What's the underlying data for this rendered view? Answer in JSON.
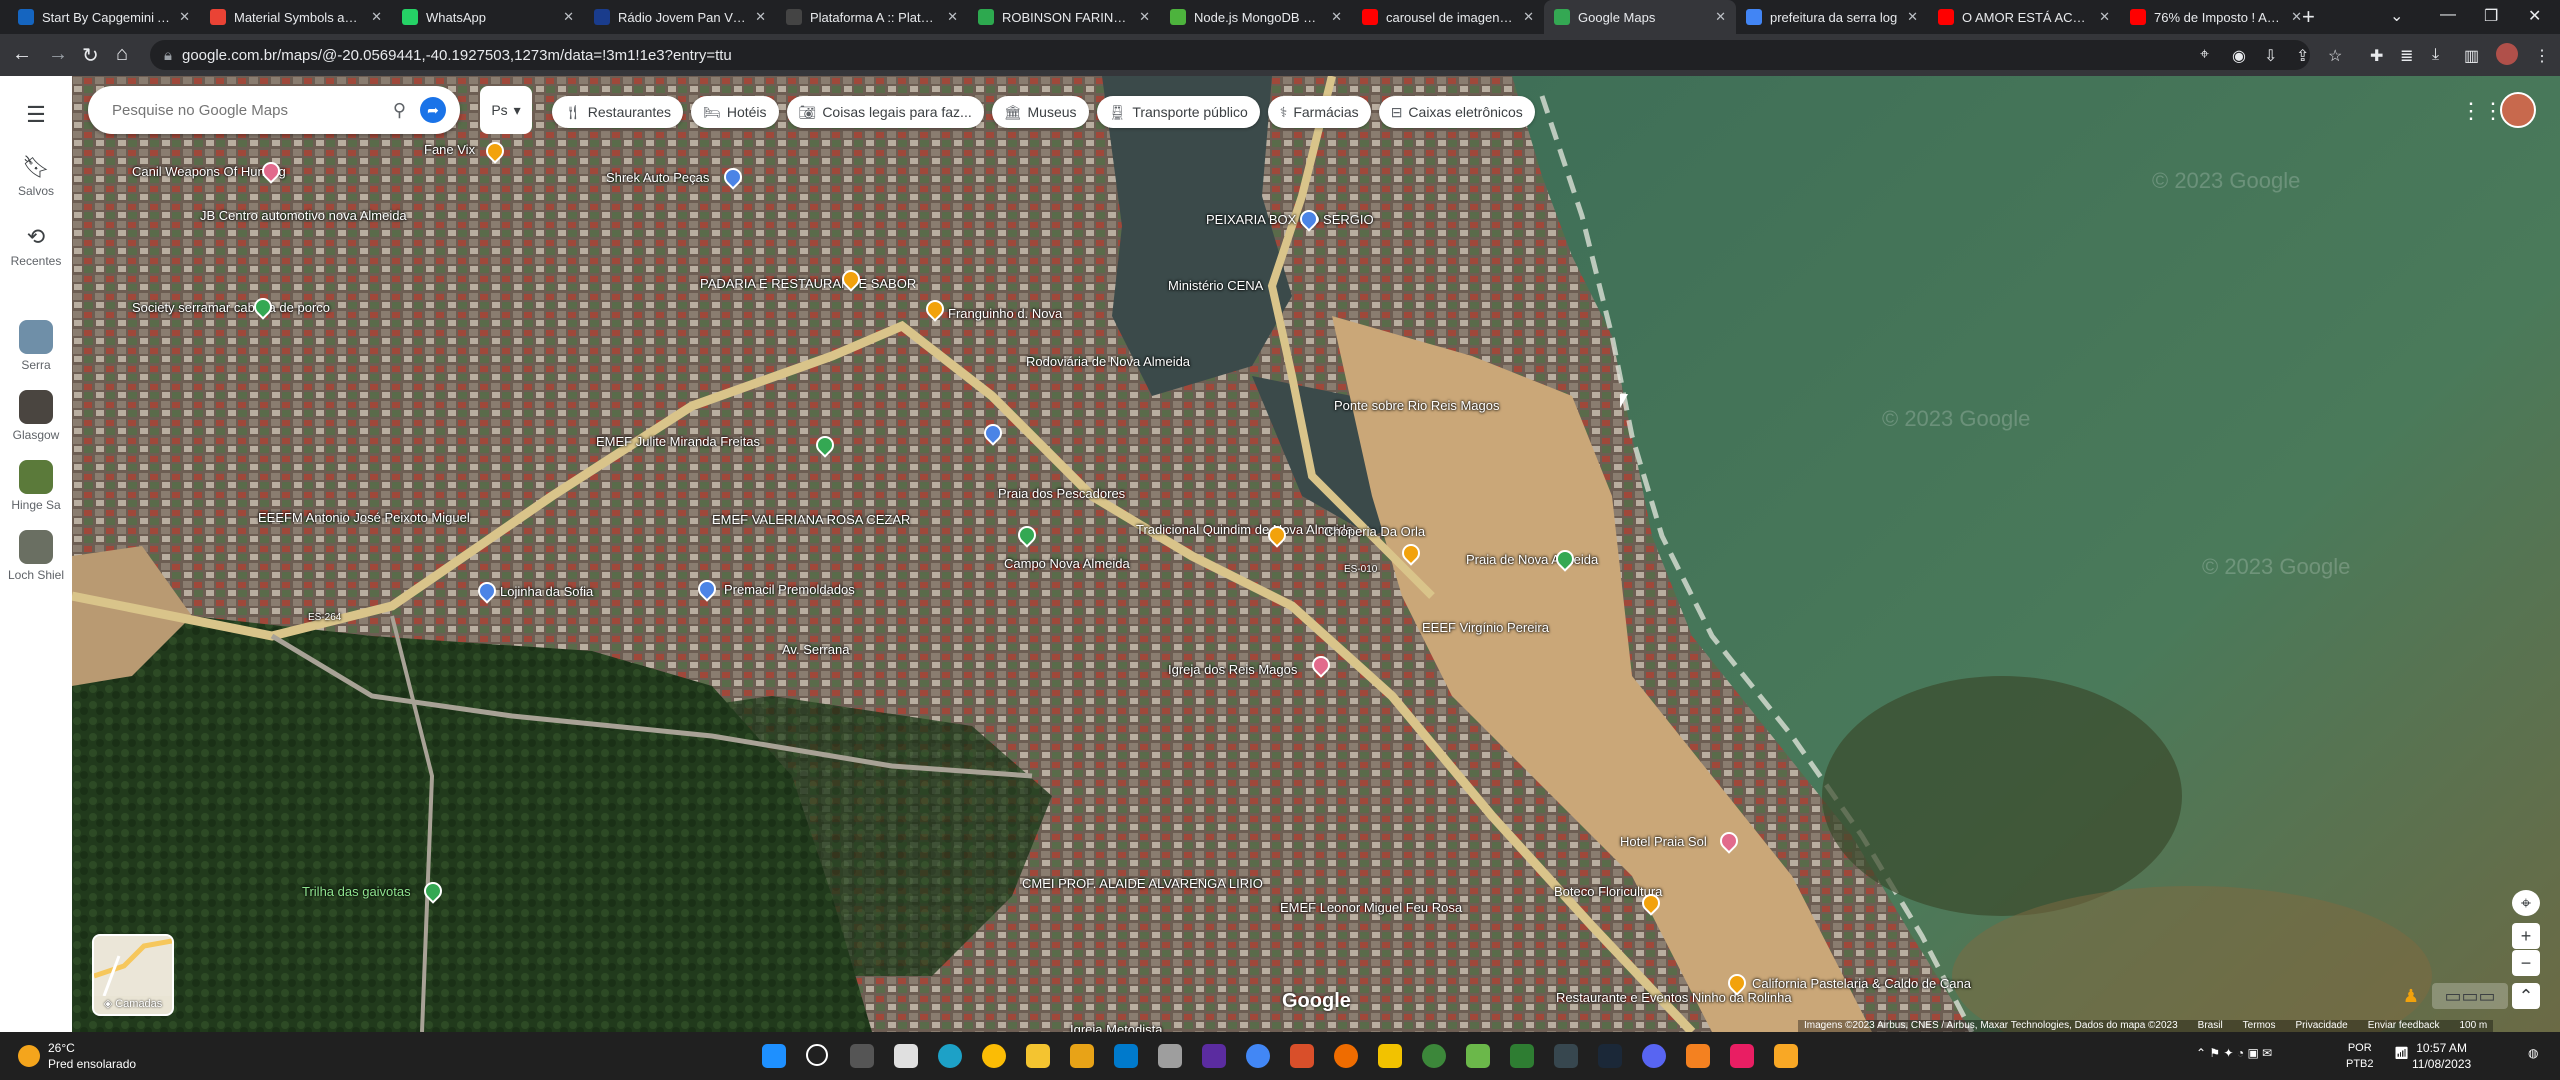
{
  "browser": {
    "tabs": [
      {
        "title": "Start By Capgemini Ac",
        "color": "#1565c0"
      },
      {
        "title": "Material Symbols and Ic",
        "color": "#ea4335"
      },
      {
        "title": "WhatsApp",
        "color": "#25d366"
      },
      {
        "title": "Rádio Jovem Pan Vitóri",
        "color": "#1a3c8c"
      },
      {
        "title": "Plataforma A :: Platafor",
        "color": "#444444"
      },
      {
        "title": "ROBINSON FARINAZZO",
        "color": "#2da94f"
      },
      {
        "title": "Node.js MongoDB Crea",
        "color": "#4db33d"
      },
      {
        "title": "carousel de imagens htr",
        "color": "#ff0000"
      },
      {
        "title": "Google Maps",
        "color": "#34a853"
      },
      {
        "title": "prefeitura da serra log",
        "color": "#4285f4"
      },
      {
        "title": "O AMOR ESTÁ ACABAN",
        "color": "#ff0000"
      },
      {
        "title": "76% de Imposto ! Advi",
        "color": "#ff0000"
      }
    ],
    "active_tab_index": 8,
    "url": "google.com.br/maps/@-20.0569441,-40.1927503,1273m/data=!3m1!1e3?entry=ttu"
  },
  "rail": {
    "menu_icon": "hamburger-icon",
    "items": [
      {
        "label": "Salvos",
        "icon": "bookmark-icon"
      },
      {
        "label": "Recentes",
        "icon": "history-icon"
      },
      {
        "label": "Serra",
        "icon": "place-thumbnail"
      },
      {
        "label": "Glasgow",
        "icon": "place-thumbnail"
      },
      {
        "label": "Hinge Sa",
        "icon": "place-thumbnail"
      },
      {
        "label": "Loch Shiel",
        "icon": "place-thumbnail"
      }
    ]
  },
  "search": {
    "placeholder": "Pesquise no Google Maps",
    "ps_label": "Ps"
  },
  "chips": [
    {
      "label": "Restaurantes",
      "icon": "fork-knife-icon"
    },
    {
      "label": "Hotéis",
      "icon": "bed-icon"
    },
    {
      "label": "Coisas legais para faz...",
      "icon": "camera-icon"
    },
    {
      "label": "Museus",
      "icon": "museum-icon"
    },
    {
      "label": "Transporte público",
      "icon": "train-icon"
    },
    {
      "label": "Farmácias",
      "icon": "pharmacy-icon"
    },
    {
      "label": "Caixas eletrônicos",
      "icon": "atm-icon"
    }
  ],
  "map": {
    "labels": [
      "Canil Weapons Of Hunting",
      "Fane Vix",
      "Shrek Auto Peças",
      "JB Centro automotivo nova Almeida",
      "PADARIA E RESTAURANTE SABOR",
      "Franguinho d. Nova",
      "PEIXARIA BOX DO SERGIO",
      "Ministério CENA",
      "Society serramar cabeça de porco",
      "Rodoviária de Nova Almeida",
      "Ponte sobre Rio Reis Magos",
      "EMEF Julite Miranda Freitas",
      "Praia dos Pescadores",
      "EEEFM Antonio José Peixoto Miguel",
      "EMEF VALERIANA ROSA CEZAR",
      "Tradicional Quindim de Nova Almeida",
      "Choperia Da Orla",
      "Praia de Nova Almeida",
      "Campo Nova Almeida",
      "Lojinha da Sofia",
      "Premacil Premoldados",
      "EEEF Virgínio Pereira",
      "Igreja dos Reis Magos",
      "Av. Serrana",
      "ES-010",
      "ES-264",
      "Trilha das gaivotas",
      "Hotel Praia Sol",
      "Boteco Floricultura",
      "CMEI PROF. ALAIDE ALVARENGA LIRIO",
      "EMEF Leonor Miguel Feu Rosa",
      "California Pastelaria & Caldo de Cana",
      "Restaurante e Eventos Ninho da Rolinha",
      "Igreja Metodista",
      "2023 Google"
    ],
    "layers_label": "Camadas",
    "google_logo": "Google",
    "attribution": [
      "Imagens ©2023 Airbus, CNES / Airbus, Maxar Technologies, Dados do mapa ©2023",
      "Brasil",
      "Termos",
      "Privacidade",
      "Enviar feedback",
      "100 m"
    ]
  },
  "taskbar": {
    "temperature": "26°C",
    "weather": "Pred ensolarado",
    "lang_top": "POR",
    "lang_bottom": "PTB2",
    "time": "10:57 AM",
    "date": "11/08/2023"
  },
  "colors": {
    "ocean": "#4a7a5a",
    "sand": "#caa778",
    "road": "#d9c48a",
    "forest": "#25401f",
    "urban": "#7c6a5c"
  }
}
